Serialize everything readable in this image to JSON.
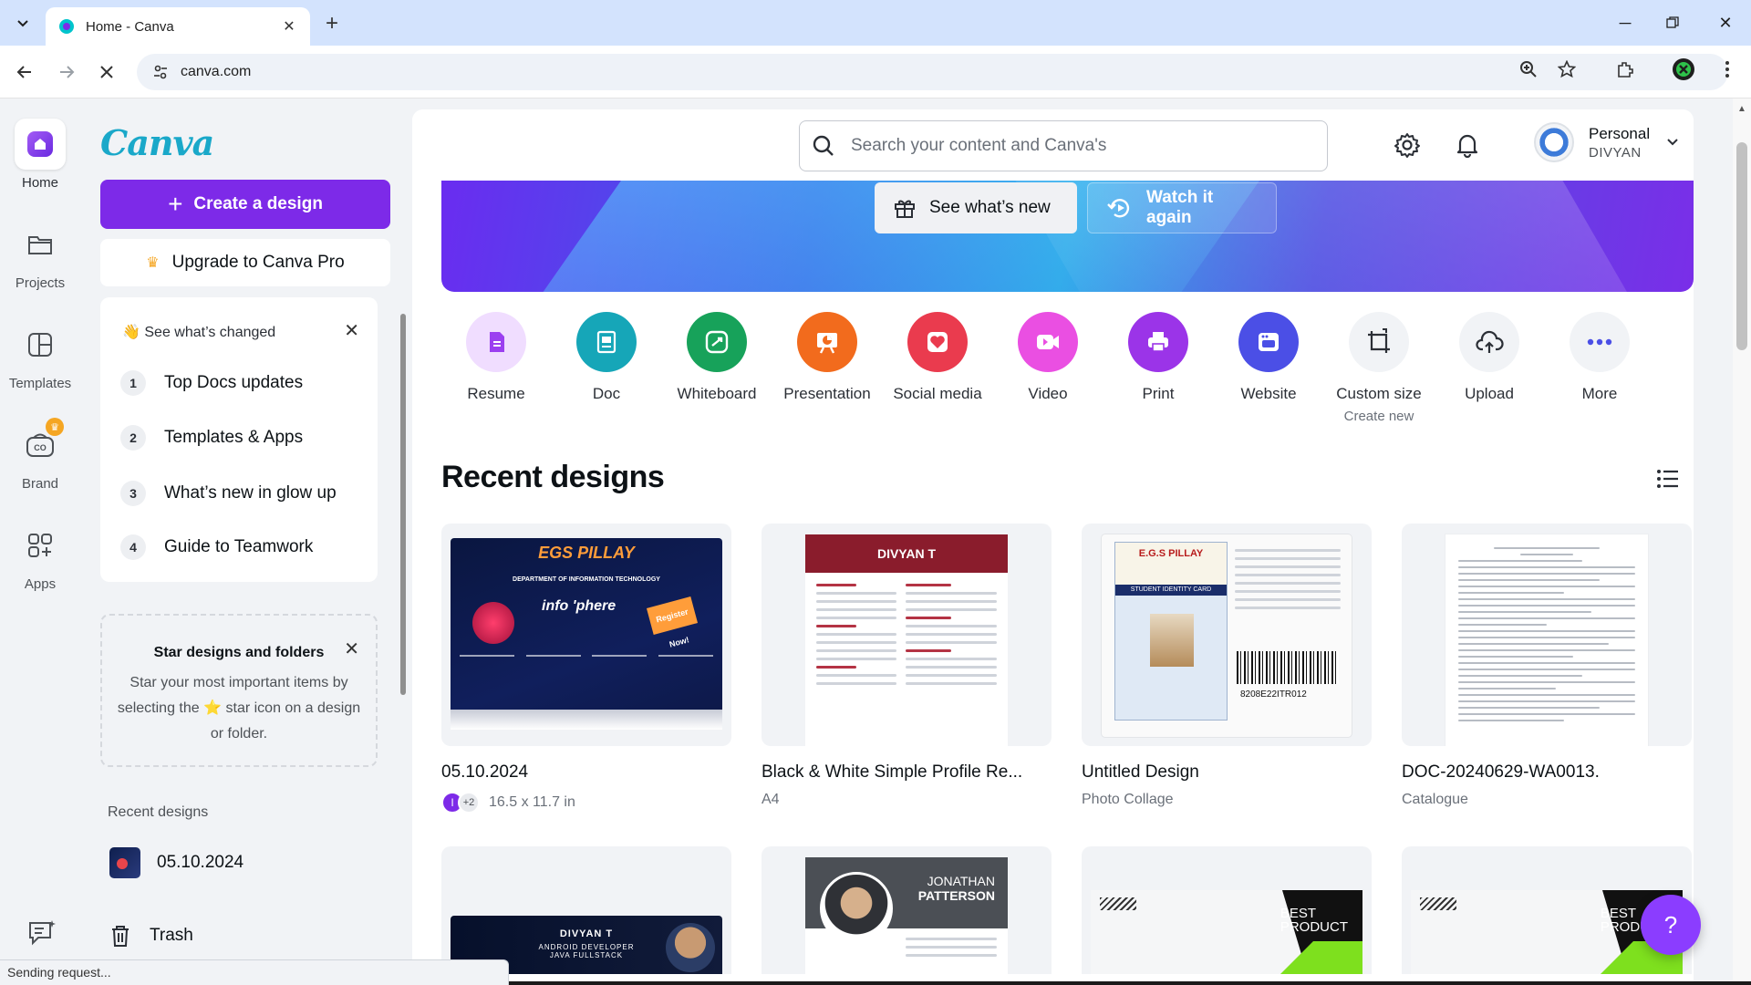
{
  "browser": {
    "tab_title": "Home - Canva",
    "url": "canva.com",
    "status_text": "Sending request..."
  },
  "rail": {
    "items": [
      {
        "label": "Home",
        "icon": "home-icon",
        "active": true
      },
      {
        "label": "Projects",
        "icon": "folder-icon"
      },
      {
        "label": "Templates",
        "icon": "templates-icon"
      },
      {
        "label": "Brand",
        "icon": "brand-icon"
      },
      {
        "label": "Apps",
        "icon": "apps-icon"
      }
    ]
  },
  "sidebar": {
    "logo": "Canva",
    "create_label": "Create a design",
    "upgrade_label": "Upgrade to Canva Pro",
    "changed": {
      "title": "👋 See what’s changed",
      "items": [
        {
          "num": "1",
          "label": "Top Docs updates"
        },
        {
          "num": "2",
          "label": "Templates & Apps"
        },
        {
          "num": "3",
          "label": "What’s new in glow up"
        },
        {
          "num": "4",
          "label": "Guide to Teamwork"
        }
      ]
    },
    "star": {
      "title": "Star designs and folders",
      "body_1": "Star your most important items by selecting the",
      "body_star": "⭐",
      "body_2": "star icon on a design or folder."
    },
    "recent_label": "Recent designs",
    "recent_item": "05.10.2024",
    "trash_label": "Trash"
  },
  "header": {
    "search_placeholder": "Search your content and Canva's",
    "account_name": "Personal",
    "account_sub": "DIVYAN"
  },
  "banner": {
    "whats_new": "See what’s new",
    "watch_again": "Watch it again"
  },
  "design_types": [
    {
      "label": "Resume",
      "color": "#f3dcff",
      "icon_color": "#9b3ff0"
    },
    {
      "label": "Doc",
      "color": "#16a6b8",
      "icon_color": "#ffffff"
    },
    {
      "label": "Whiteboard",
      "color": "#17a25a",
      "icon_color": "#ffffff"
    },
    {
      "label": "Presentation",
      "color": "#f26b1d",
      "icon_color": "#ffffff"
    },
    {
      "label": "Social media",
      "color": "#ea3b4e",
      "icon_color": "#ffffff"
    },
    {
      "label": "Video",
      "color": "#ea4fe2",
      "icon_color": "#ffffff"
    },
    {
      "label": "Print",
      "color": "#9b34e8",
      "icon_color": "#ffffff"
    },
    {
      "label": "Website",
      "color": "#4b4fe6",
      "icon_color": "#ffffff"
    },
    {
      "label": "Custom size",
      "sub": "Create new",
      "color": "#f1f3f6",
      "icon_color": "#2b2f36"
    },
    {
      "label": "Upload",
      "color": "#f1f3f6",
      "icon_color": "#2b2f36"
    },
    {
      "label": "More",
      "color": "#f1f3f6",
      "icon_color": "#4b4fe6"
    }
  ],
  "recent": {
    "title": "Recent designs",
    "designs": [
      {
        "title": "05.10.2024",
        "sub": "16.5 x 11.7 in",
        "collab_initial": "I",
        "collab_more": "+2"
      },
      {
        "title": "Black & White Simple Profile Re...",
        "sub": "A4"
      },
      {
        "title": "Untitled Design",
        "sub": "Photo Collage"
      },
      {
        "title": "DOC-20240629-WA0013.",
        "sub": "Catalogue"
      }
    ],
    "thumb_text": {
      "poster_title": "EGS PILLAY",
      "poster_dept": "DEPARTMENT OF INFORMATION TECHNOLOGY",
      "poster_event": "info 'phere",
      "poster_register": "Register Now!",
      "resume_name": "DIVYAN T",
      "id_head": "E.G.S PILLAY",
      "id_card_label": "STUDENT IDENTITY CARD",
      "id_barcode": "8208E22ITR012",
      "dark_name": "DIVYAN T",
      "dark_role_1": "ANDROID DEVELOPER",
      "dark_role_2": "JAVA FULLSTACK",
      "jp_first": "JONATHAN",
      "jp_last": "PATTERSON",
      "bp_text_1": "BEST",
      "bp_text_2": "PRODUCT"
    }
  },
  "help_label": "?"
}
